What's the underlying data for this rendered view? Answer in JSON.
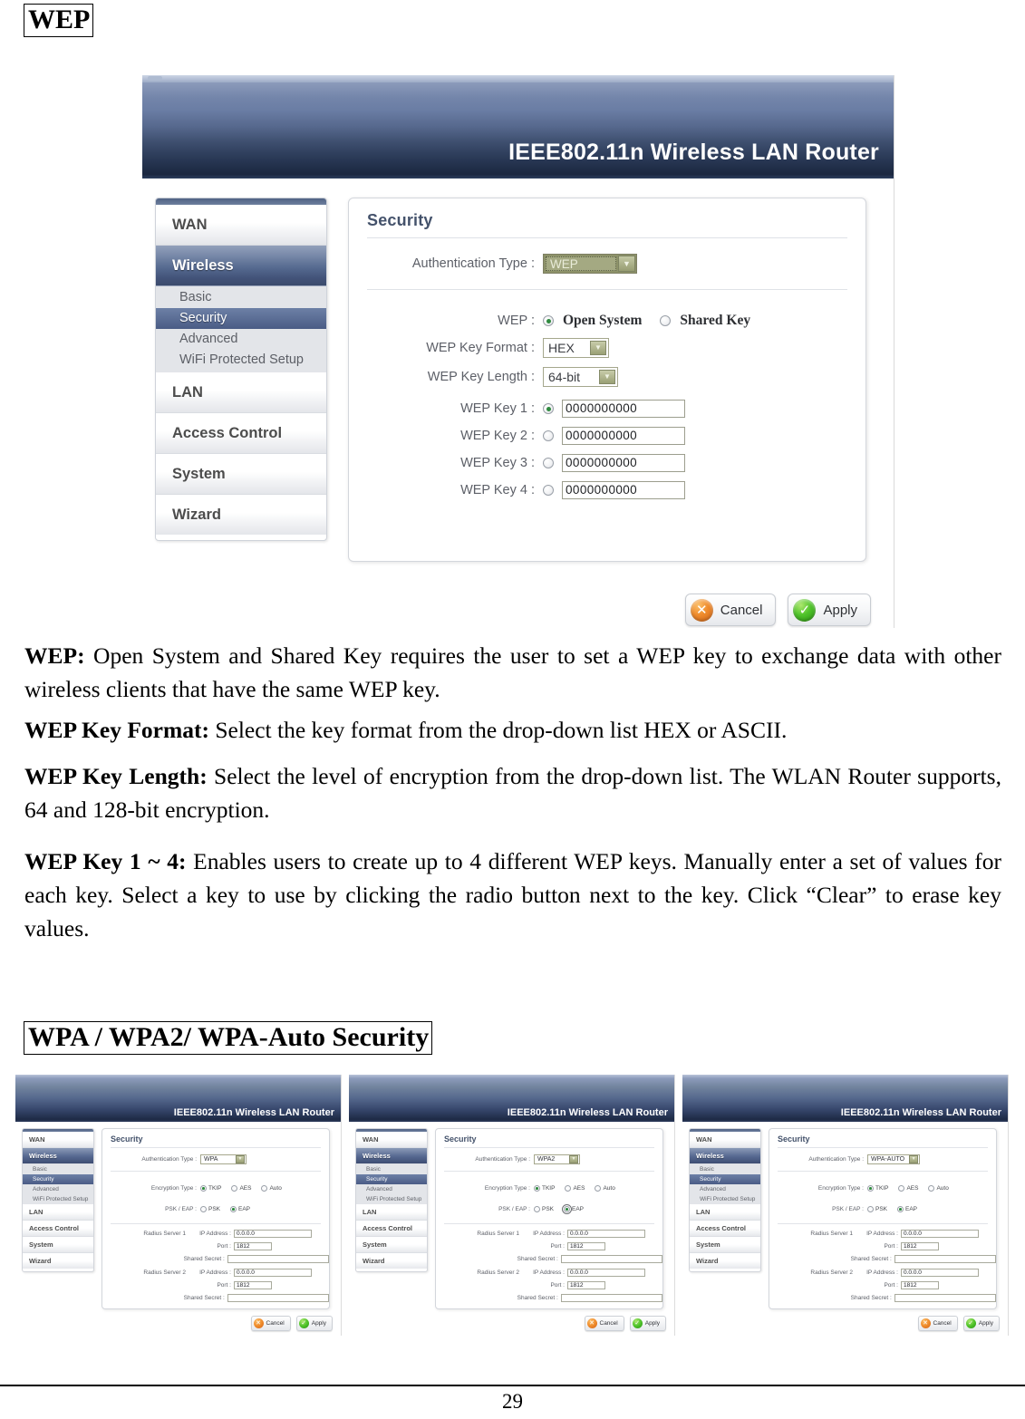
{
  "document": {
    "wep_heading": "WEP",
    "wpa_heading": "WPA / WPA2/ WPA-Auto Security",
    "page_number": "29"
  },
  "paragraphs": {
    "p1_label": "WEP:",
    "p1_text": " Open System and Shared Key requires the user to set a WEP key to exchange data with other wireless clients that have the same WEP key.",
    "p2_label": "WEP Key Format:",
    "p2_text": " Select the key format from the drop-down list HEX or ASCII.",
    "p3_label": "WEP Key Length:",
    "p3_text": " Select the level of encryption from the drop-down list. The WLAN Router supports, 64 and 128-bit encryption.",
    "p4_label": "WEP Key 1 ~ 4:",
    "p4_text": " Enables users to create up to 4 different WEP keys. Manually enter a set of values for each key. Select a key to use by clicking the radio button next to the key. Click “Clear” to erase key values."
  },
  "router": {
    "banner_title": "IEEE802.11n  Wireless LAN Router",
    "sidebar": [
      {
        "label": "WAN",
        "active": false
      },
      {
        "label": "Wireless",
        "active": true
      },
      {
        "label": "LAN",
        "active": false
      },
      {
        "label": "Access Control",
        "active": false
      },
      {
        "label": "System",
        "active": false
      },
      {
        "label": "Wizard",
        "active": false
      }
    ],
    "sub_items": [
      {
        "label": "Basic",
        "active": false
      },
      {
        "label": "Security",
        "active": true
      },
      {
        "label": "Advanced",
        "active": false
      },
      {
        "label": "WiFi Protected Setup",
        "active": false
      }
    ],
    "panel_title": "Security",
    "fields": {
      "auth_type_label": "Authentication Type :",
      "auth_type_value": "WEP",
      "wep_label": "WEP :",
      "wep_option_open": "Open System",
      "wep_option_shared": "Shared Key",
      "key_format_label": "WEP Key Format :",
      "key_format_value": "HEX",
      "key_length_label": "WEP Key Length :",
      "key_length_value": "64-bit",
      "keys": [
        {
          "label": "WEP Key 1 :",
          "value": "0000000000",
          "selected": true
        },
        {
          "label": "WEP Key 2 :",
          "value": "0000000000",
          "selected": false
        },
        {
          "label": "WEP Key 3 :",
          "value": "0000000000",
          "selected": false
        },
        {
          "label": "WEP Key 4 :",
          "value": "0000000000",
          "selected": false
        }
      ]
    },
    "buttons": {
      "cancel_label": "Cancel",
      "cancel_icon": "cross-icon",
      "apply_label": "Apply",
      "apply_icon": "check-icon"
    },
    "colors": {
      "banner_top": "#b9c4d8",
      "banner_bottom": "#1b2740",
      "nav_active": "#56688d",
      "sub_active": "#4a5c85",
      "panel_title": "#44526b",
      "combo_selected_bg": "#8d9269",
      "cancel_orange": "#ef8b2b",
      "apply_green": "#4fc32a",
      "radio_dot": "#2f8a3f"
    }
  },
  "thumbnails": [
    {
      "banner_title": "IEEE802.11n  Wireless LAN Router",
      "panel_title": "Security",
      "auth_type_label": "Authentication Type :",
      "auth_type_value": "WPA",
      "encryption_label": "Encryption Type :",
      "encryption_options": [
        "TKIP",
        "AES",
        "Auto"
      ],
      "encryption_selected": "TKIP",
      "psk_eap_label": "PSK / EAP :",
      "psk_eap_options": [
        "PSK",
        "EAP"
      ],
      "psk_eap_selected": "EAP",
      "psk_eap_focused": false,
      "radius1_label": "Radius Server 1",
      "radius2_label": "Radius Server 2",
      "ip_label": "IP Address :",
      "ip_value": "0.0.0.0",
      "port_label": "Port :",
      "port_value": "1812",
      "secret_label": "Shared Secret :",
      "secret_value": "",
      "cancel_label": "Cancel",
      "apply_label": "Apply",
      "sidebar": [
        "WAN",
        "Wireless",
        "LAN",
        "Access Control",
        "System",
        "Wizard"
      ],
      "sub_items": [
        "Basic",
        "Security",
        "Advanced",
        "WiFi Protected Setup"
      ]
    },
    {
      "banner_title": "IEEE802.11n  Wireless LAN Router",
      "panel_title": "Security",
      "auth_type_label": "Authentication Type :",
      "auth_type_value": "WPA2",
      "encryption_label": "Encryption Type :",
      "encryption_options": [
        "TKIP",
        "AES",
        "Auto"
      ],
      "encryption_selected": "TKIP",
      "psk_eap_label": "PSK / EAP :",
      "psk_eap_options": [
        "PSK",
        "EAP"
      ],
      "psk_eap_selected": "EAP",
      "psk_eap_focused": true,
      "radius1_label": "Radius Server 1",
      "radius2_label": "Radius Server 2",
      "ip_label": "IP Address :",
      "ip_value": "0.0.0.0",
      "port_label": "Port :",
      "port_value": "1812",
      "secret_label": "Shared Secret :",
      "secret_value": "",
      "cancel_label": "Cancel",
      "apply_label": "Apply",
      "sidebar": [
        "WAN",
        "Wireless",
        "LAN",
        "Access Control",
        "System",
        "Wizard"
      ],
      "sub_items": [
        "Basic",
        "Security",
        "Advanced",
        "WiFi Protected Setup"
      ]
    },
    {
      "banner_title": "IEEE802.11n  Wireless LAN Router",
      "panel_title": "Security",
      "auth_type_label": "Authentication Type :",
      "auth_type_value": "WPA-AUTO",
      "encryption_label": "Encryption Type :",
      "encryption_options": [
        "TKIP",
        "AES",
        "Auto"
      ],
      "encryption_selected": "TKIP",
      "psk_eap_label": "PSK / EAP :",
      "psk_eap_options": [
        "PSK",
        "EAP"
      ],
      "psk_eap_selected": "EAP",
      "psk_eap_focused": false,
      "radius1_label": "Radius Server 1",
      "radius2_label": "Radius Server 2",
      "ip_label": "IP Address :",
      "ip_value": "0.0.0.0",
      "port_label": "Port :",
      "port_value": "1812",
      "secret_label": "Shared Secret :",
      "secret_value": "",
      "cancel_label": "Cancel",
      "apply_label": "Apply",
      "sidebar": [
        "WAN",
        "Wireless",
        "LAN",
        "Access Control",
        "System",
        "Wizard"
      ],
      "sub_items": [
        "Basic",
        "Security",
        "Advanced",
        "WiFi Protected Setup"
      ]
    }
  ]
}
